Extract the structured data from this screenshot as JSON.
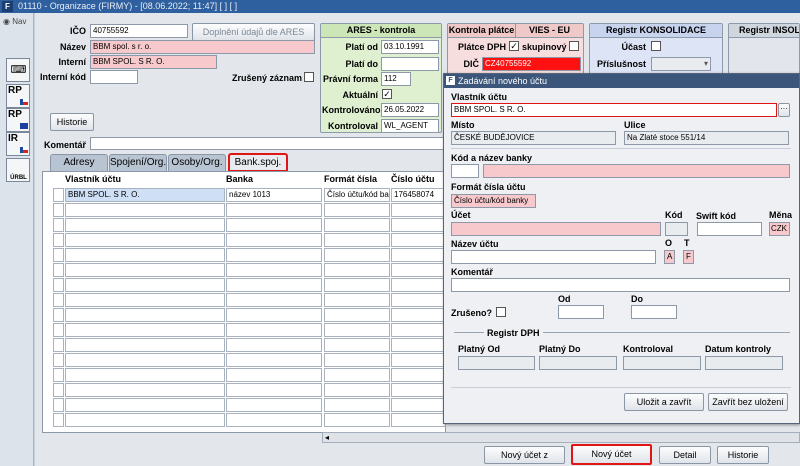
{
  "window": {
    "title": "01110 - Organizace (FIRMY) - [08.06.2022; 11:47]  [ ]  [ ]"
  },
  "leftbar": {
    "nav_label": "Nav",
    "icons": [
      {
        "label": ""
      },
      {
        "label": "RP"
      },
      {
        "label": "RP"
      },
      {
        "label": "IR"
      },
      {
        "label": "ÚRBL"
      }
    ]
  },
  "form": {
    "ico_label": "IČO",
    "ico_value": "40755592",
    "doplneni_button": "Doplnění údajů dle ARES",
    "nazev_label": "Název",
    "nazev_value": "BBM spol. s r. o.",
    "interni_label": "Interní",
    "interni_value": "BBM SPOL. S R. O.",
    "interni_kod_label": "Interní kód",
    "interni_kod_value": "",
    "zruseny_label": "Zrušený záznam",
    "historie_button": "Historie",
    "komentar_label": "Komentář",
    "komentar_value": ""
  },
  "ares": {
    "title": "ARES - kontrola",
    "plati_od_label": "Platí od",
    "plati_od_value": "03.10.1991",
    "plati_do_label": "Platí do",
    "plati_do_value": "",
    "pravni_forma_label": "Právní forma",
    "pravni_forma_value": "112",
    "aktualni_label": "Aktuální",
    "kontrolovano_label": "Kontrolováno",
    "kontrolovano_value": "26.05.2022",
    "kontroloval_label": "Kontroloval",
    "kontroloval_value": "WL_AGENT"
  },
  "kontrola_platce": {
    "title": "Kontrola plátce",
    "vies_title": "VIES - EU",
    "platce_dph_label": "Plátce DPH",
    "skupinovy_label": "skupinový",
    "dic_label": "DIČ",
    "dic_value": "CZ40755592"
  },
  "registr_konsolidace": {
    "title": "Registr KONSOLIDACE",
    "ucast_label": "Účast",
    "prislusnost_label": "Příslušnost"
  },
  "registr_insolvenci": {
    "title": "Registr INSOLV"
  },
  "tabs": [
    {
      "label": "Adresy"
    },
    {
      "label": "Spojení/Org."
    },
    {
      "label": "Osoby/Org."
    },
    {
      "label": "Bank.spoj."
    }
  ],
  "grid": {
    "columns": [
      "Vlastník účtu",
      "Banka",
      "Formát čísla",
      "Číslo účtu"
    ],
    "rows": [
      {
        "owner": "BBM SPOL. S R. O.",
        "bank": "název 1013",
        "format": "Číslo účtu/kód ban",
        "number": "176458074"
      }
    ]
  },
  "bottom_buttons": {
    "novy_ucet_z_registru": "Nový účet z registru",
    "novy_ucet": "Nový účet",
    "detail": "Detail",
    "historie": "Historie"
  },
  "dialog": {
    "title": "Zadávání nového účtu",
    "vlastnik_label": "Vlastník účtu",
    "vlastnik_value": "BBM SPOL. S R. O.",
    "misto_label": "Místo",
    "misto_value": "ČESKÉ BUDĚJOVICE",
    "ulice_label": "Ulice",
    "ulice_value": "Na Zlaté stoce 551/14",
    "kod_nazev_banky_label": "Kód a název banky",
    "format_label": "Formát čísla účtu",
    "format_value": "Číslo účtu/kód banky",
    "ucet_label": "Účet",
    "kod_label": "Kód",
    "swift_label": "Swift kód",
    "mena_label": "Měna",
    "mena_value": "CZK",
    "nazev_uctu_label": "Název účtu",
    "o_label": "O",
    "o_value": "A",
    "t_label": "T",
    "t_value": "F",
    "komentar_label": "Komentář",
    "zruseno_label": "Zrušeno?",
    "od_label": "Od",
    "do_label": "Do",
    "registr_dph_title": "Registr DPH",
    "platny_od_label": "Platný Od",
    "platny_do_label": "Platný Do",
    "kontroloval_label": "Kontroloval",
    "datum_kontroly_label": "Datum kontroly",
    "ulozit_button": "Uložit a zavřít",
    "zavrit_button": "Zavřít bez uložení"
  }
}
